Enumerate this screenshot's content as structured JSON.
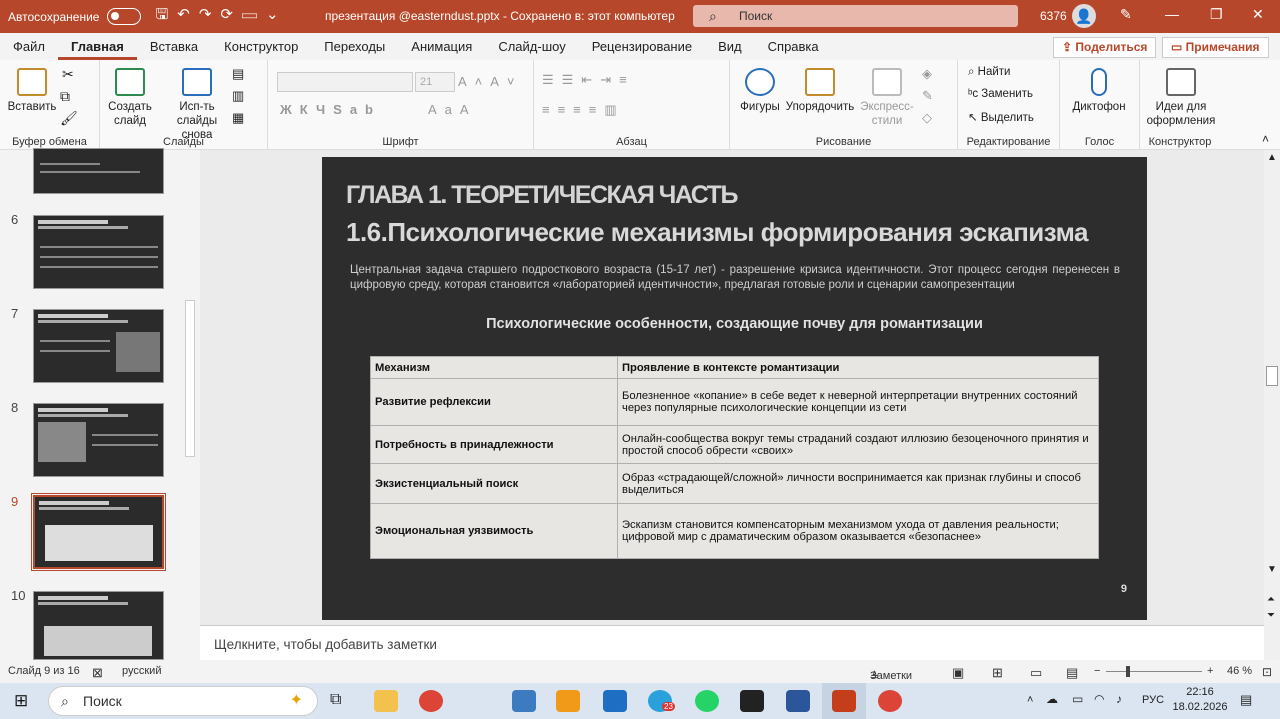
{
  "titlebar": {
    "autosave": "Автосохранение",
    "doc_title": "презентация @easterndust.pptx  -  Сохранено в: этот компьютер",
    "search_placeholder": "Поиск",
    "user_number": "6376"
  },
  "tabs": [
    "Файл",
    "Главная",
    "Вставка",
    "Конструктор",
    "Переходы",
    "Анимация",
    "Слайд-шоу",
    "Рецензирование",
    "Вид",
    "Справка"
  ],
  "share_label": "Поделиться",
  "comments_label": "Примечания",
  "ribbon": {
    "paste": "Вставить",
    "clipboard": "Буфер обмена",
    "new_slide": "Создать слайд",
    "reuse_slides": "Исп-ть слайды снова",
    "slides": "Слайды",
    "font_size": "21",
    "font": "Шрифт",
    "paragraph": "Абзац",
    "shapes": "Фигуры",
    "arrange": "Упорядочить",
    "quick_styles": "Экспресс-стили",
    "drawing": "Рисование",
    "find": "Найти",
    "replace": "Заменить",
    "select": "Выделить",
    "editing": "Редактирование",
    "dictate": "Диктофон",
    "voice": "Голос",
    "design_ideas": "Идеи для оформления",
    "designer": "Конструктор"
  },
  "thumbnails": [
    {
      "num": "6"
    },
    {
      "num": "7"
    },
    {
      "num": "8"
    },
    {
      "num": "9"
    },
    {
      "num": "10"
    }
  ],
  "slide": {
    "heading1": "ГЛАВА 1. ТЕОРЕТИЧЕСКАЯ ЧАСТЬ",
    "heading2": "1.6.Психологические механизмы формирования эскапизма",
    "intro": "Центральная задача старшего подросткового возраста (15-17 лет) - разрешение кризиса идентичности. Этот процесс сегодня перенесен в цифровую среду, которая становится «лабораторией идентичности», предлагая готовые роли и сценарии самопрезентации",
    "subtitle": "Психологические особенности, создающие почву для романтизации",
    "table": {
      "headers": [
        "Механизм",
        "Проявление в контексте романтизации"
      ],
      "rows": [
        [
          "Развитие рефлексии",
          "Болезненное «копание» в себе ведет к неверной интерпретации внутренних состояний через популярные психологические концепции из сети"
        ],
        [
          "Потребность в принадлежности",
          "Онлайн-сообщества вокруг темы страданий создают иллюзию безоценочного принятия и простой способ обрести «своих»"
        ],
        [
          "Экзистенциальный поиск",
          "Образ «страдающей/сложной» личности воспринимается как признак глубины и способ выделиться"
        ],
        [
          "Эмоциональная уязвимость",
          "Эскапизм становится компенсаторным механизмом ухода от давления реальности; цифровой мир с драматическим образом оказывается «безопаснее»"
        ]
      ]
    },
    "page_number": "9"
  },
  "notes_placeholder": "Щелкните, чтобы добавить заметки",
  "status": {
    "slide_info": "Слайд 9 из 16",
    "language": "русский",
    "notes": "Заметки",
    "zoom": "46 %"
  },
  "taskbar": {
    "search": "Поиск",
    "lang": "РУС",
    "time": "22:16",
    "date": "18.02.2026",
    "telegram_badge": "23"
  }
}
